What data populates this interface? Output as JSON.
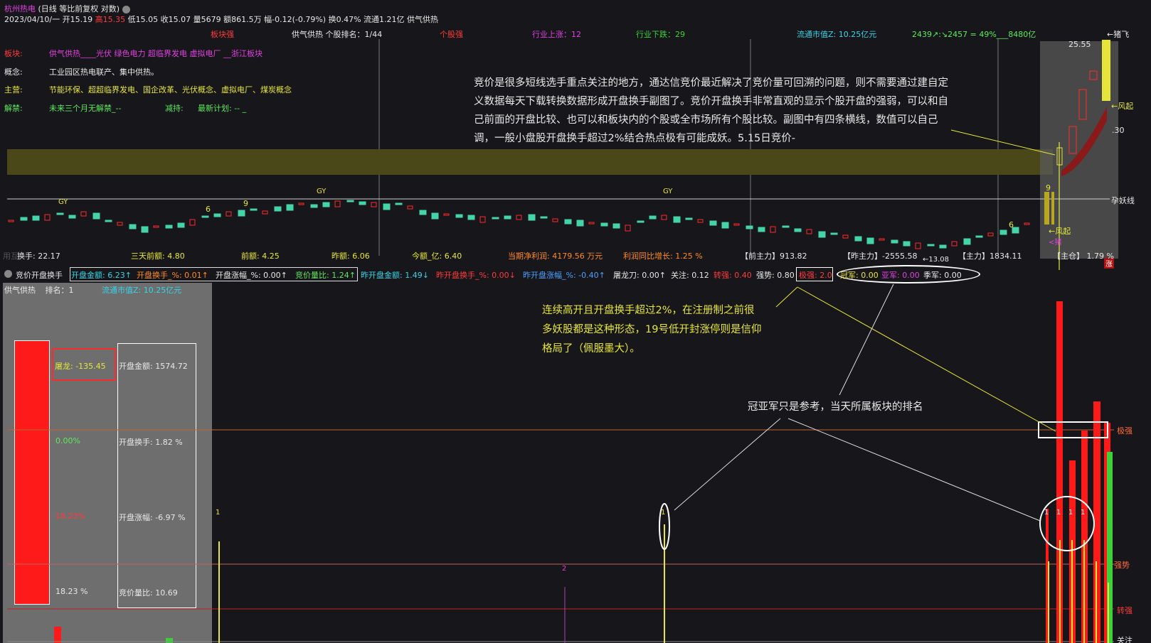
{
  "header": {
    "stock_name": "杭州热电",
    "mode": "(日线 等比前复权 对数)",
    "quote": {
      "date": "2023/04/10/一",
      "open": "开15.19",
      "high": "高15.35",
      "low": "低15.05",
      "close": "收15.07",
      "volume": "量5679",
      "amount": "额861.5万",
      "change": "幅-0.12(-0.79%)",
      "turnover": "换0.47%",
      "float": "流通1.21亿",
      "sector": "供气供热"
    },
    "stats": {
      "sector_strong": "板块强",
      "rank": "供气供热 个股排名：1/44",
      "stock_strong": "个股强",
      "industry_up": "行业上涨：12",
      "industry_down": "行业下跌：29",
      "float_mcap": "流通市值Z: 10.25亿元",
      "market_summary": "2439↗:↘2457 = 49%___8480亿",
      "top_right": "←猪飞"
    }
  },
  "info_panel": {
    "rows": [
      {
        "label": "板块:",
        "value": "供气供热____光伏 绿色电力 超临界发电 虚拟电厂 __浙江板块"
      },
      {
        "label": "概念:",
        "value": "工业园区热电联产、集中供热。"
      },
      {
        "label": "主营:",
        "value": "节能环保、超超临界发电、国企改革、光伏概念、虚拟电厂、煤炭概念"
      },
      {
        "label": "解禁:",
        "value": "未来三个月无解禁_--",
        "extra_label": "减持:",
        "extra_value": "最新计划: -- _"
      }
    ]
  },
  "annotations": {
    "main_note": "竞价是很多短线选手重点关注的地方，通达信竞价最近解决了竞价量可回溯的问题，则不需要通过建自定义数据每天下载转换数据形成开盘换手副图了。竞价开盘换手非常直观的显示个股开盘的强弱，可以和自己前面的开盘比较、也可以和板块内的个股或全市场所有个股比较。副图中有四条横线，数值可以自己调，一般小盘股开盘换手超过2%结合热点极有可能成妖。5.15日竞价-",
    "note_2": "连续高开且开盘换手超过2%，在注册制之前很多妖股都是这种形态，19号低开封涨停则是信仰格局了（佩服墨大）。",
    "note_3": "冠亚军只是参考，当天所属板块的排名"
  },
  "main_chart": {
    "markers": [
      "GY",
      "GY",
      "GY"
    ],
    "numbers": [
      "6",
      "9",
      "9",
      "6"
    ],
    "price_labels": {
      "p1": "25.55",
      "p2": ".30",
      "fengqi": "←风起",
      "fengqi2": "←风起",
      "yaoxian": "孕妖线",
      "zhu": "<猪",
      "zhang": "涨",
      "min": "←13.08"
    },
    "bottom_stats": [
      {
        "label": "换手: 22.17",
        "cls": "c-wht"
      },
      {
        "label": "三天前额: 4.80",
        "cls": "c-yel"
      },
      {
        "label": "前额: 4.25",
        "cls": "c-yel"
      },
      {
        "label": "昨额: 6.06",
        "cls": "c-yel"
      },
      {
        "label": "今额_亿: 6.40",
        "cls": "c-yel"
      },
      {
        "label": "当期净利润: 4179.56 万元",
        "cls": "c-orange"
      },
      {
        "label": "利润同比增长: 1.25 %",
        "cls": "c-orange"
      },
      {
        "label": "【前主力】913.82",
        "cls": "c-wht"
      },
      {
        "label": "【昨主力】-2555.58",
        "cls": "c-wht"
      },
      {
        "label": "【主力】1834.11",
        "cls": "c-wht"
      },
      {
        "label": "【主仓】 1.79 %",
        "cls": "c-wht"
      }
    ],
    "used": "用互"
  },
  "sub_header": {
    "title": "竞价开盘换手",
    "items": [
      {
        "label": "开盘金额: 6.23↑",
        "cls": "c-cyan"
      },
      {
        "label": "开盘换手_%: 0.01↑",
        "cls": "c-orange"
      },
      {
        "label": "开盘涨幅_%: 0.00↑",
        "cls": "c-wht"
      },
      {
        "label": "竞价量比: 1.24↑",
        "cls": "c-ltgreen"
      },
      {
        "label": "昨开盘金额: 1.49↓",
        "cls": "c-cyan"
      },
      {
        "label": "昨开盘换手_%: 0.00↓",
        "cls": "c-red"
      },
      {
        "label": "昨开盘涨幅_%: -0.40↑",
        "cls": "c-blue"
      },
      {
        "label": "屠龙刀: 0.00↑",
        "cls": "c-wht"
      },
      {
        "label": "关注: 0.12",
        "cls": "c-wht"
      },
      {
        "label": "转强: 0.40",
        "cls": "c-red"
      },
      {
        "label": "强势: 0.80",
        "cls": "c-wht"
      },
      {
        "label": "极强: 2.0",
        "cls": "c-red"
      },
      {
        "label": "冠军: 0.00",
        "cls": "c-yel"
      },
      {
        "label": "亚军: 0.00",
        "cls": "c-mag"
      },
      {
        "label": "季军: 0.00",
        "cls": "c-wht"
      }
    ],
    "row2_left": "供气供热",
    "row2_rank": "排名：1",
    "row2_mcap": "流通市值Z: 10.25亿元"
  },
  "left_panel": {
    "tulong": "屠龙: -135.45",
    "pct1": "0.00%",
    "pct2": "18.23%",
    "pct3": "18.23 %",
    "stats": [
      "开盘金额: 1574.72",
      "开盘换手: 1.82 %",
      "开盘涨幅: -6.97 %",
      "竞价量比: 10.69"
    ]
  },
  "sub_chart": {
    "level_labels": {
      "jiqiang": "极强",
      "qiangshi": "强势",
      "zhuanqiang": "转强",
      "guanzhu": "关注"
    },
    "bar_labels": [
      "1",
      "1",
      "2",
      "1",
      "1",
      "1",
      "1"
    ]
  },
  "colors": {
    "bg": "#17171b",
    "up": "#ff2a2a",
    "down": "#45d3a8",
    "yellow": "#e6e63a",
    "olive": "#4d4a18"
  }
}
